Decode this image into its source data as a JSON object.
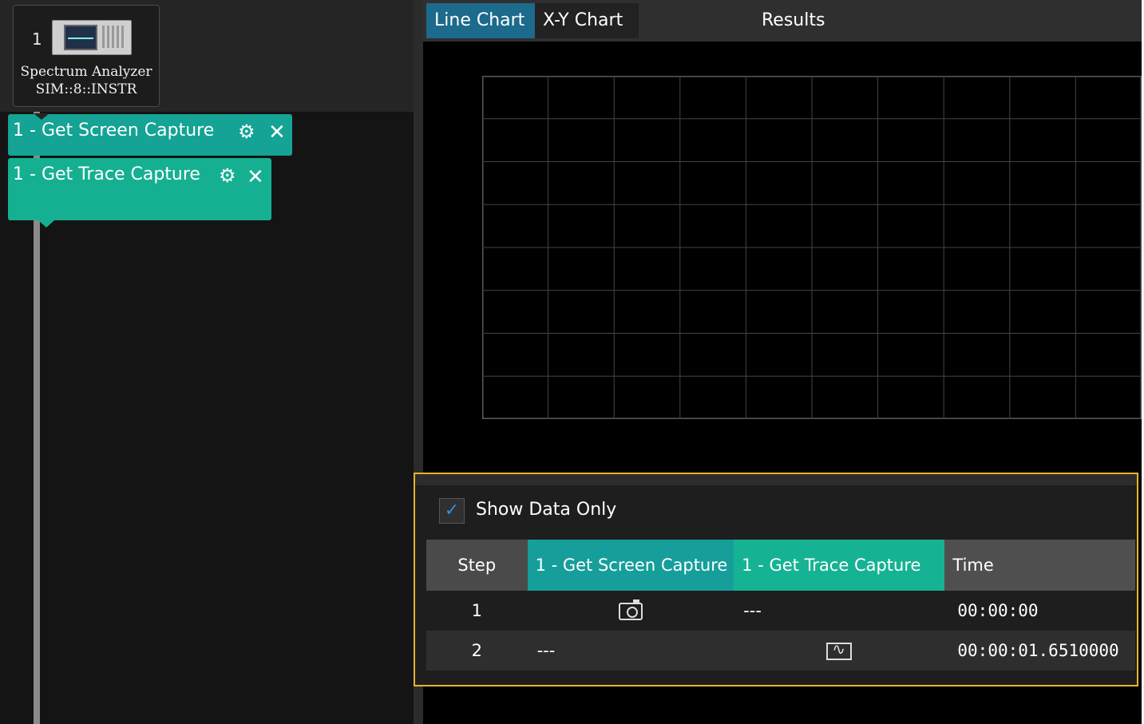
{
  "instrument": {
    "index": "1",
    "name": "Spectrum Analyzer",
    "address": "SIM::8::INSTR"
  },
  "steps": [
    {
      "number": "1 -",
      "label": "Get Screen Capture",
      "settings_icon": "gear-icon",
      "remove_icon": "close-icon"
    },
    {
      "number": "1 -",
      "label": "Get Trace Capture",
      "settings_icon": "gear-icon",
      "remove_icon": "close-icon"
    }
  ],
  "tabs": [
    {
      "label": "Line Chart",
      "active": true
    },
    {
      "label": "X-Y Chart",
      "active": false
    }
  ],
  "panel_title": "Results",
  "chart_data": {
    "type": "line",
    "series": [],
    "grid": true,
    "x_divisions": 10,
    "y_divisions": 8
  },
  "results": {
    "show_data_only": {
      "label": "Show Data Only",
      "checked": true,
      "check_glyph": "✓"
    },
    "columns": [
      "Step",
      "1 - Get Screen Capture",
      "1 - Get Trace Capture",
      "Time"
    ],
    "rows": [
      {
        "step": "1",
        "screen": "camera-icon",
        "trace": "---",
        "time": "00:00:00"
      },
      {
        "step": "2",
        "screen": "---",
        "trace": "trace-icon",
        "time": "00:00:01.6510000"
      }
    ]
  },
  "colors": {
    "accent_tab": "#1c6a8c",
    "step_teal": "#14a394",
    "highlight_border": "#e6b42c",
    "checkbox_check": "#2e8fe0"
  }
}
